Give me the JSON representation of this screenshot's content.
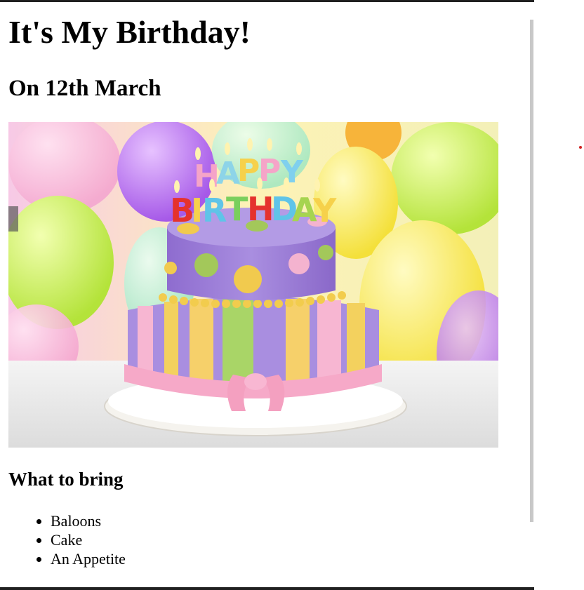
{
  "page": {
    "title": "It's My Birthday!",
    "subtitle": "On 12th March",
    "image_alt": "birthday-cake-image",
    "image_text": "HAPPY BIRTHDAY",
    "section_heading": "What to bring",
    "items": [
      "Baloons",
      "Cake",
      "An Appetite"
    ]
  },
  "colors": {
    "border": "#202020",
    "scrollbar": "#c8c8c8",
    "marker": "#d02020"
  }
}
